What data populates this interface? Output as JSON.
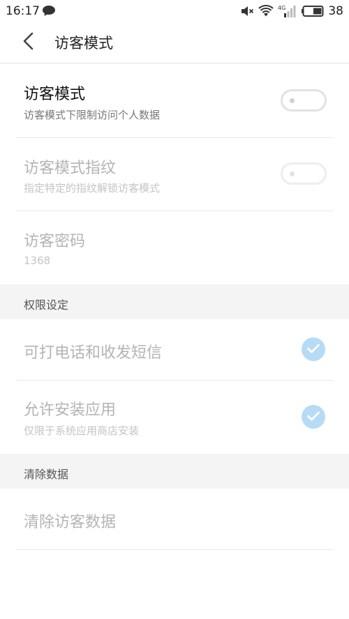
{
  "status_bar": {
    "time": "16:17",
    "battery": "38",
    "network": "4G",
    "icons": [
      "chat-bubble-icon",
      "mute-icon",
      "wifi-icon",
      "signal-icon",
      "battery-icon"
    ]
  },
  "header": {
    "title": "访客模式",
    "back_icon": "chevron-left-icon"
  },
  "rows": {
    "guest_mode": {
      "title": "访客模式",
      "subtitle": "访客模式下限制访问个人数据",
      "enabled": false
    },
    "guest_fingerprint": {
      "title": "访客模式指纹",
      "subtitle": "指定特定的指纹解锁访客模式",
      "enabled": false
    },
    "guest_password": {
      "title": "访客密码",
      "value": "1368"
    }
  },
  "sections": {
    "permissions": {
      "label": "权限设定",
      "items": [
        {
          "title": "可打电话和收发短信",
          "checked": true
        },
        {
          "title": "允许安装应用",
          "subtitle": "仅限于系统应用商店安装",
          "checked": true
        }
      ]
    },
    "clear_data": {
      "label": "清除数据",
      "items": [
        {
          "title": "清除访客数据"
        }
      ]
    }
  },
  "colors": {
    "check_fill": "#b6dcf5",
    "section_bg": "#f4f4f4",
    "disabled_text": "#b4b4b4"
  }
}
